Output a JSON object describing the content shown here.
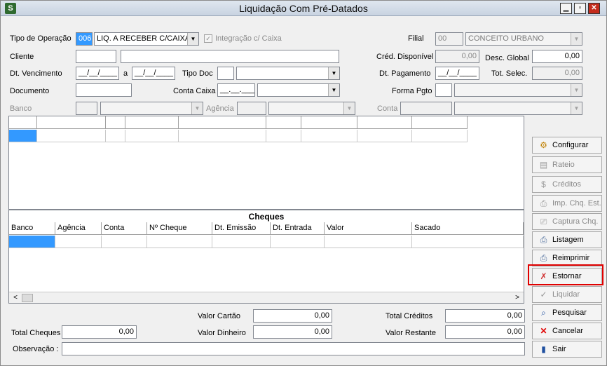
{
  "window": {
    "title": "Liquidação Com Pré-Datados",
    "app_icon": "S"
  },
  "form": {
    "tipo_operacao_label": "Tipo de Operação",
    "tipo_operacao_code": "006",
    "tipo_operacao_value": "LIQ. A RECEBER C/CAIXA",
    "integracao_label": "Integração c/ Caixa",
    "filial_label": "Filial",
    "filial_code": "00",
    "filial_name": "CONCEITO URBANO",
    "cliente_label": "Cliente",
    "cred_disponivel_label": "Créd. Disponível",
    "cred_disponivel_value": "0,00",
    "desc_global_label": "Desc. Global",
    "desc_global_value": "0,00",
    "dt_vencimento_label": "Dt. Vencimento",
    "date_placeholder": "__/__/____",
    "a_label": "a",
    "tipo_doc_label": "Tipo Doc",
    "dt_pagamento_label": "Dt. Pagamento",
    "tot_selec_label": "Tot. Selec.",
    "tot_selec_value": "0,00",
    "documento_label": "Documento",
    "conta_caixa_label": "Conta Caixa",
    "conta_caixa_mask": "__.__.___",
    "forma_pgto_label": "Forma Pgto",
    "banco_label": "Banco",
    "agencia_label": "Agência",
    "conta_label": "Conta"
  },
  "cheques": {
    "title": "Cheques",
    "columns": [
      "Banco",
      "Agência",
      "Conta",
      "Nº Cheque",
      "Dt. Emissão",
      "Dt. Entrada",
      "Valor",
      "Sacado"
    ]
  },
  "totals": {
    "valor_cartao_label": "Valor Cartão",
    "valor_cartao_value": "0,00",
    "total_creditos_label": "Total Créditos",
    "total_creditos_value": "0,00",
    "total_cheques_label": "Total Cheques",
    "total_cheques_value": "0,00",
    "valor_dinheiro_label": "Valor Dinheiro",
    "valor_dinheiro_value": "0,00",
    "valor_restante_label": "Valor Restante",
    "valor_restante_value": "0,00",
    "observacao_label": "Observação :"
  },
  "sidebar": {
    "configurar": "Configurar",
    "rateio": "Rateio",
    "creditos": "Créditos",
    "imp_chq_est": "Imp. Chq. Est.",
    "captura_chq": "Captura Chq.",
    "listagem": "Listagem",
    "reimprimir": "Reimprimir",
    "estornar": "Estornar",
    "liquidar": "Liquidar",
    "pesquisar": "Pesquisar",
    "cancelar": "Cancelar",
    "sair": "Sair"
  },
  "colors": {
    "selection": "#3399ff",
    "highlight": "#e00000"
  }
}
